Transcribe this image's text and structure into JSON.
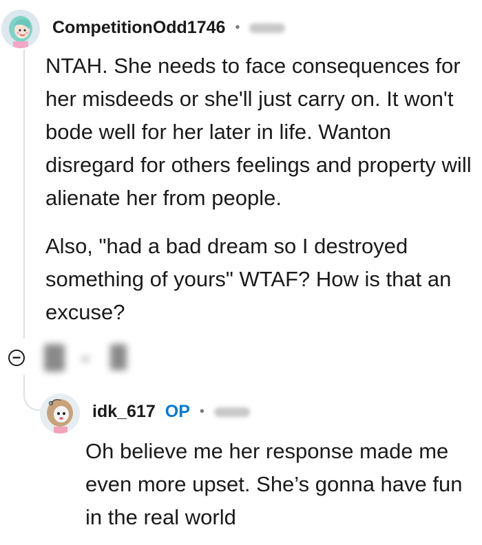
{
  "comment": {
    "username": "CompetitionOdd1746",
    "separator": "•",
    "paragraphs": [
      "NTAH. She needs to face consequences for her misdeeds or she'll just carry on. It won't bode well for her later in life. Wanton disregard for others feelings and property will alienate her from people.",
      "Also, \"had a bad dream so I destroyed something of yours\" WTAF? How is that an excuse?"
    ],
    "collapse_icon": "collapse-minus-icon"
  },
  "reply": {
    "username": "idk_617",
    "badge": "OP",
    "separator": "•",
    "text": "Oh believe me her response made me even more upset. She’s gonna have fun in the real world"
  }
}
